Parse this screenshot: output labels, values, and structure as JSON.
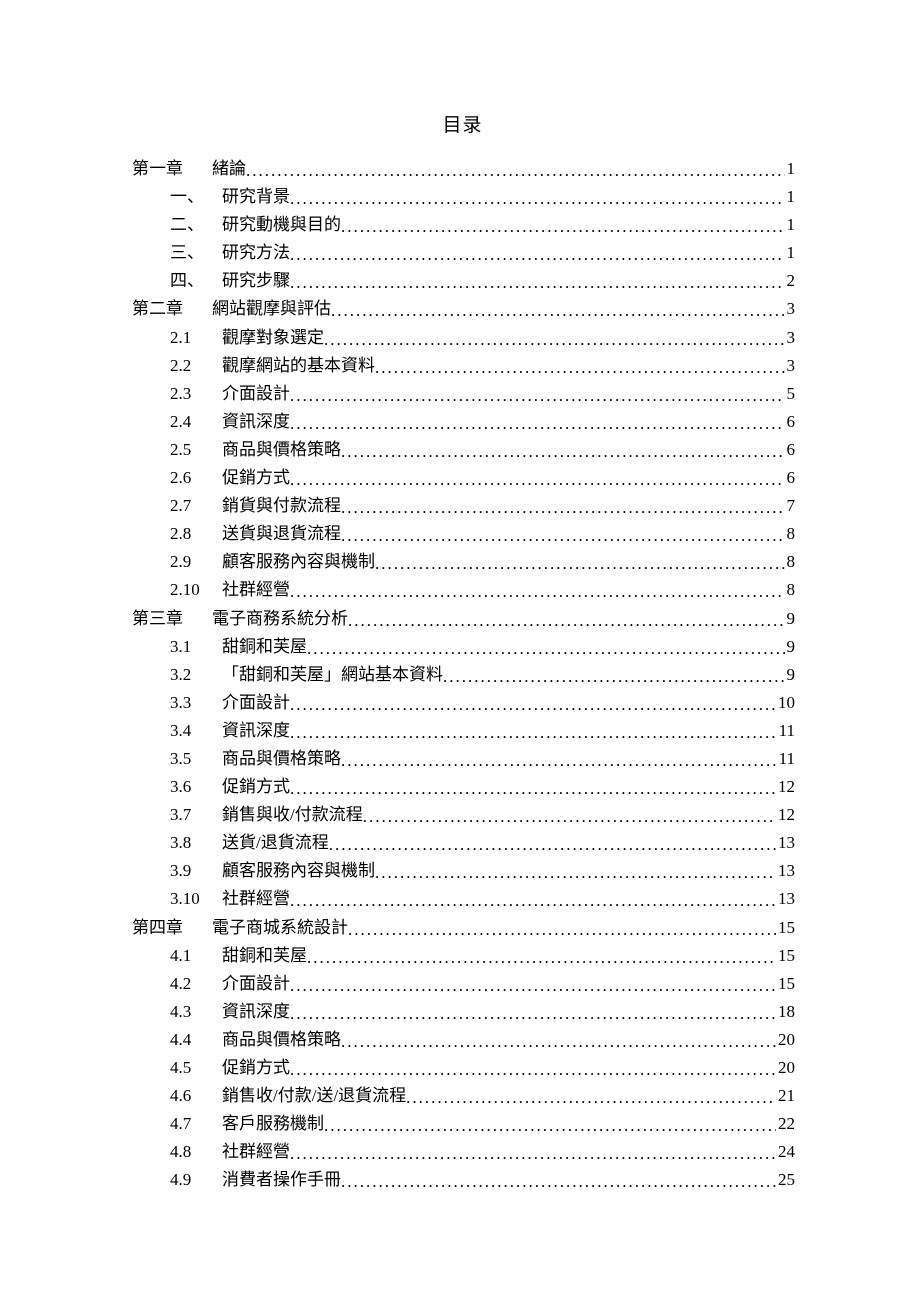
{
  "title": "目录",
  "entries": [
    {
      "level": 1,
      "num": "第一章",
      "text": "緒論",
      "page": "1"
    },
    {
      "level": 2,
      "num": "一、",
      "text": "研究背景",
      "page": "1"
    },
    {
      "level": 2,
      "num": "二、",
      "text": "研究動機與目的",
      "page": "1"
    },
    {
      "level": 2,
      "num": "三、",
      "text": "研究方法",
      "page": "1"
    },
    {
      "level": 2,
      "num": "四、",
      "text": "研究步驟",
      "page": "2"
    },
    {
      "level": 1,
      "num": "第二章",
      "text": "網站觀摩與評估",
      "page": "3"
    },
    {
      "level": 2,
      "num": "2.1",
      "text": "觀摩對象選定",
      "page": "3"
    },
    {
      "level": 2,
      "num": "2.2",
      "text": "觀摩網站的基本資料",
      "page": "3"
    },
    {
      "level": 2,
      "num": "2.3",
      "text": "介面設計",
      "page": "5"
    },
    {
      "level": 2,
      "num": "2.4",
      "text": "資訊深度",
      "page": "6"
    },
    {
      "level": 2,
      "num": "2.5",
      "text": "商品與價格策略",
      "page": "6"
    },
    {
      "level": 2,
      "num": "2.6",
      "text": "促銷方式",
      "page": "6"
    },
    {
      "level": 2,
      "num": "2.7",
      "text": "銷貨與付款流程",
      "page": "7"
    },
    {
      "level": 2,
      "num": "2.8",
      "text": "送貨與退貨流程",
      "page": "8"
    },
    {
      "level": 2,
      "num": "2.9",
      "text": "顧客服務內容與機制",
      "page": "8"
    },
    {
      "level": 2,
      "num": "2.10",
      "text": "社群經營",
      "page": "8"
    },
    {
      "level": 1,
      "num": "第三章",
      "text": "電子商務系統分析",
      "page": "9"
    },
    {
      "level": 2,
      "num": "3.1",
      "text": "甜銅和芙屋",
      "page": "9"
    },
    {
      "level": 2,
      "num": "3.2",
      "text": "「甜銅和芙屋」網站基本資料",
      "page": "9"
    },
    {
      "level": 2,
      "num": "3.3",
      "text": "介面設計",
      "page": "10"
    },
    {
      "level": 2,
      "num": "3.4",
      "text": "資訊深度",
      "page": "11"
    },
    {
      "level": 2,
      "num": "3.5",
      "text": "商品與價格策略",
      "page": "11"
    },
    {
      "level": 2,
      "num": "3.6",
      "text": "促銷方式",
      "page": "12"
    },
    {
      "level": 2,
      "num": "3.7",
      "text": "銷售與收/付款流程",
      "page": "12"
    },
    {
      "level": 2,
      "num": "3.8",
      "text": "送貨/退貨流程",
      "page": "13"
    },
    {
      "level": 2,
      "num": "3.9",
      "text": "顧客服務內容與機制",
      "page": "13"
    },
    {
      "level": 2,
      "num": "3.10",
      "text": "社群經營",
      "page": "13"
    },
    {
      "level": 1,
      "num": "第四章",
      "text": "電子商城系統設計",
      "page": "15"
    },
    {
      "level": 2,
      "num": "4.1",
      "text": "甜銅和芙屋",
      "page": "15"
    },
    {
      "level": 2,
      "num": "4.2",
      "text": "介面設計",
      "page": "15"
    },
    {
      "level": 2,
      "num": "4.3",
      "text": "資訊深度",
      "page": "18"
    },
    {
      "level": 2,
      "num": "4.4",
      "text": "商品與價格策略",
      "page": "20"
    },
    {
      "level": 2,
      "num": "4.5",
      "text": "促銷方式",
      "page": "20"
    },
    {
      "level": 2,
      "num": "4.6",
      "text": "銷售收/付款/送/退貨流程",
      "page": "21"
    },
    {
      "level": 2,
      "num": "4.7",
      "text": "客戶服務機制",
      "page": "22"
    },
    {
      "level": 2,
      "num": "4.8",
      "text": "社群經營",
      "page": "24"
    },
    {
      "level": 2,
      "num": "4.9",
      "text": "消費者操作手冊",
      "page": "25"
    }
  ]
}
